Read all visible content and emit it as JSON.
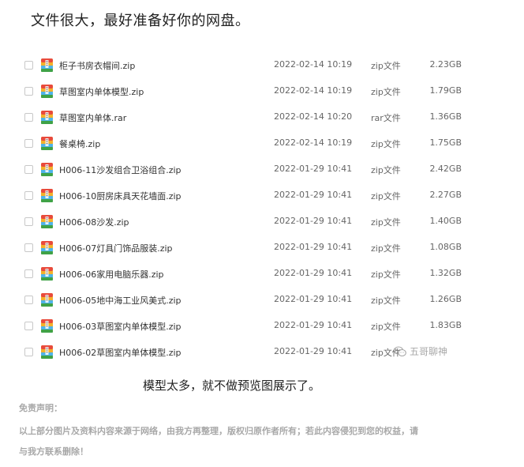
{
  "page_title": "文件很大，最好准备好你的网盘。",
  "files": [
    {
      "name": "柜子书房衣帽间.zip",
      "date": "2022-02-14 10:19",
      "type": "zip文件",
      "size": "2.23GB"
    },
    {
      "name": "草图室内单体模型.zip",
      "date": "2022-02-14 10:19",
      "type": "zip文件",
      "size": "1.79GB"
    },
    {
      "name": "草图室内单体.rar",
      "date": "2022-02-14 10:20",
      "type": "rar文件",
      "size": "1.36GB"
    },
    {
      "name": "餐桌椅.zip",
      "date": "2022-02-14 10:19",
      "type": "zip文件",
      "size": "1.75GB"
    },
    {
      "name": "H006-11沙发组合卫浴组合.zip",
      "date": "2022-01-29 10:41",
      "type": "zip文件",
      "size": "2.42GB"
    },
    {
      "name": "H006-10厨房床具天花墙面.zip",
      "date": "2022-01-29 10:41",
      "type": "zip文件",
      "size": "2.27GB"
    },
    {
      "name": "H006-08沙发.zip",
      "date": "2022-01-29 10:41",
      "type": "zip文件",
      "size": "1.40GB"
    },
    {
      "name": "H006-07灯具门饰品服装.zip",
      "date": "2022-01-29 10:41",
      "type": "zip文件",
      "size": "1.08GB"
    },
    {
      "name": "H006-06家用电脑乐器.zip",
      "date": "2022-01-29 10:41",
      "type": "zip文件",
      "size": "1.32GB"
    },
    {
      "name": "H006-05地中海工业风美式.zip",
      "date": "2022-01-29 10:41",
      "type": "zip文件",
      "size": "1.26GB"
    },
    {
      "name": "H006-03草图室内单体模型.zip",
      "date": "2022-01-29 10:41",
      "type": "zip文件",
      "size": "1.83GB"
    },
    {
      "name": "H006-02草图室内单体模型.zip",
      "date": "2022-01-29 10:41",
      "type": "zip文件",
      "size": ""
    }
  ],
  "watermark_text": "五哥聊神",
  "note": "模型太多，就不做预览图展示了。",
  "disclaimer": {
    "title": "免责声明：",
    "line1": "以上部分图片及资料内容来源于网络，由我方再整理，版权归原作者所有；若此内容侵犯到您的权益，请",
    "line2": "与我方联系删除！"
  },
  "colors": {
    "icon_top": "#e84a3c",
    "icon_mid": "#f3b02a",
    "icon_low": "#4fb3e8",
    "icon_base": "#3fa247"
  },
  "icons": {
    "file": "zip-archive-icon",
    "watermark": "wechat-icon"
  }
}
